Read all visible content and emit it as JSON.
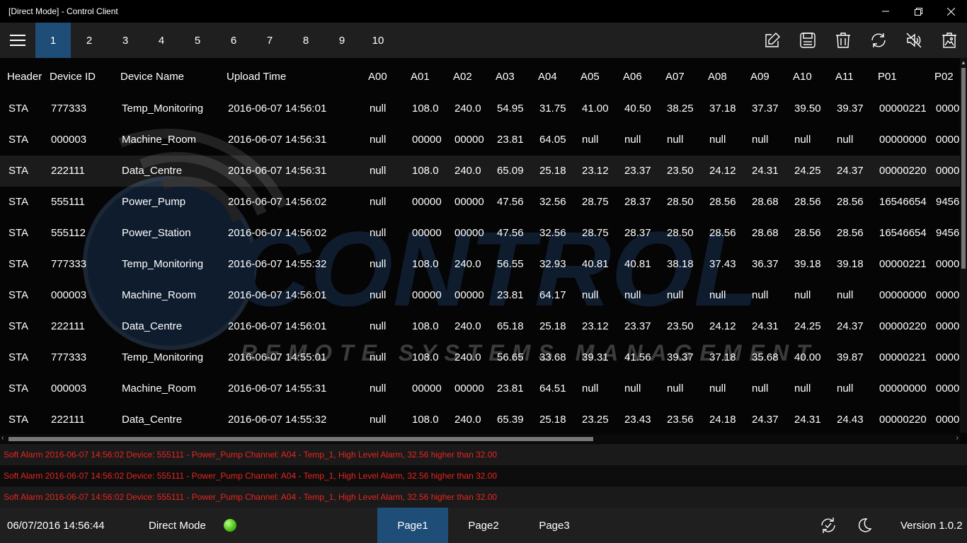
{
  "window": {
    "title": "[Direct Mode] - Control Client",
    "controls": [
      "minimize-icon",
      "restore-icon",
      "close-icon"
    ]
  },
  "toolbar": {
    "menu_icon": "hamburger-menu-icon",
    "tabs": [
      "1",
      "2",
      "3",
      "4",
      "5",
      "6",
      "7",
      "8",
      "9",
      "10"
    ],
    "active_tab": "1",
    "actions": [
      "edit-icon",
      "save-icon",
      "delete-icon",
      "refresh-icon",
      "mute-icon",
      "clear-icon"
    ]
  },
  "table": {
    "columns": [
      "Header",
      "Device ID",
      "Device Name",
      "Upload Time",
      "A00",
      "A01",
      "A02",
      "A03",
      "A04",
      "A05",
      "A06",
      "A07",
      "A08",
      "A09",
      "A10",
      "A11",
      "P01",
      "P02"
    ],
    "rows": [
      [
        "STA",
        "777333",
        "Temp_Monitoring",
        "2016-06-07 14:56:01",
        "null",
        "108.0",
        "240.0",
        "54.95",
        "31.75",
        "41.00",
        "40.50",
        "38.25",
        "37.18",
        "37.37",
        "39.50",
        "39.37",
        "00000221",
        "0000"
      ],
      [
        "STA",
        "000003",
        "Machine_Room",
        "2016-06-07 14:56:31",
        "null",
        "00000",
        "00000",
        "23.81",
        "64.05",
        "null",
        "null",
        "null",
        "null",
        "null",
        "null",
        "null",
        "00000000",
        "0000"
      ],
      [
        "STA",
        "222111",
        "Data_Centre",
        "2016-06-07 14:56:31",
        "null",
        "108.0",
        "240.0",
        "65.09",
        "25.18",
        "23.12",
        "23.37",
        "23.50",
        "24.12",
        "24.31",
        "24.25",
        "24.37",
        "00000220",
        "0000"
      ],
      [
        "STA",
        "555111",
        "Power_Pump",
        "2016-06-07 14:56:02",
        "null",
        "00000",
        "00000",
        "47.56",
        "32.56",
        "28.75",
        "28.37",
        "28.50",
        "28.56",
        "28.68",
        "28.56",
        "28.56",
        "16546654",
        "9456"
      ],
      [
        "STA",
        "555112",
        "Power_Station",
        "2016-06-07 14:56:02",
        "null",
        "00000",
        "00000",
        "47.56",
        "32.56",
        "28.75",
        "28.37",
        "28.50",
        "28.56",
        "28.68",
        "28.56",
        "28.56",
        "16546654",
        "9456"
      ],
      [
        "STA",
        "777333",
        "Temp_Monitoring",
        "2016-06-07 14:55:32",
        "null",
        "108.0",
        "240.0",
        "56.55",
        "32.93",
        "40.81",
        "40.81",
        "38.18",
        "37.43",
        "36.37",
        "39.18",
        "39.18",
        "00000221",
        "0000"
      ],
      [
        "STA",
        "000003",
        "Machine_Room",
        "2016-06-07 14:56:01",
        "null",
        "00000",
        "00000",
        "23.81",
        "64.17",
        "null",
        "null",
        "null",
        "null",
        "null",
        "null",
        "null",
        "00000000",
        "0000"
      ],
      [
        "STA",
        "222111",
        "Data_Centre",
        "2016-06-07 14:56:01",
        "null",
        "108.0",
        "240.0",
        "65.18",
        "25.18",
        "23.12",
        "23.37",
        "23.50",
        "24.12",
        "24.31",
        "24.25",
        "24.37",
        "00000220",
        "0000"
      ],
      [
        "STA",
        "777333",
        "Temp_Monitoring",
        "2016-06-07 14:55:01",
        "null",
        "108.0",
        "240.0",
        "56.65",
        "33.68",
        "39.31",
        "41.56",
        "39.37",
        "37.18",
        "35.68",
        "40.00",
        "39.87",
        "00000221",
        "0000"
      ],
      [
        "STA",
        "000003",
        "Machine_Room",
        "2016-06-07 14:55:31",
        "null",
        "00000",
        "00000",
        "23.81",
        "64.51",
        "null",
        "null",
        "null",
        "null",
        "null",
        "null",
        "null",
        "00000000",
        "0000"
      ],
      [
        "STA",
        "222111",
        "Data_Centre",
        "2016-06-07 14:55:32",
        "null",
        "108.0",
        "240.0",
        "65.39",
        "25.18",
        "23.25",
        "23.43",
        "23.56",
        "24.18",
        "24.37",
        "24.31",
        "24.43",
        "00000220",
        "0000"
      ]
    ],
    "highlighted_row": 2
  },
  "alarms": [
    "Soft Alarm 2016-06-07 14:56:02 Device: 555111 - Power_Pump Channel: A04 - Temp_1, High Level Alarm, 32.56 higher than 32.00",
    "Soft Alarm 2016-06-07 14:56:02 Device: 555111 - Power_Pump Channel: A04 - Temp_1, High Level Alarm, 32.56 higher than 32.00",
    "Soft Alarm 2016-06-07 14:56:02 Device: 555111 - Power_Pump Channel: A04 - Temp_1, High Level Alarm, 32.56 higher than 32.00"
  ],
  "status": {
    "datetime": "06/07/2016 14:56:44",
    "mode": "Direct Mode",
    "indicator_color": "#52c41a",
    "pages": [
      "Page1",
      "Page2",
      "Page3"
    ],
    "active_page": "Page1",
    "icons": [
      "sync-icon",
      "moon-icon"
    ],
    "version": "Version 1.0.2"
  },
  "watermark": {
    "brand": "CONTROL",
    "tagline": "REMOTE SYSTEMS MANAGEMENT"
  },
  "colors": {
    "accent": "#1e4d78",
    "alarm_text": "#e8251f",
    "bar_bg": "#1f1f1f",
    "content_bg": "#050505"
  }
}
